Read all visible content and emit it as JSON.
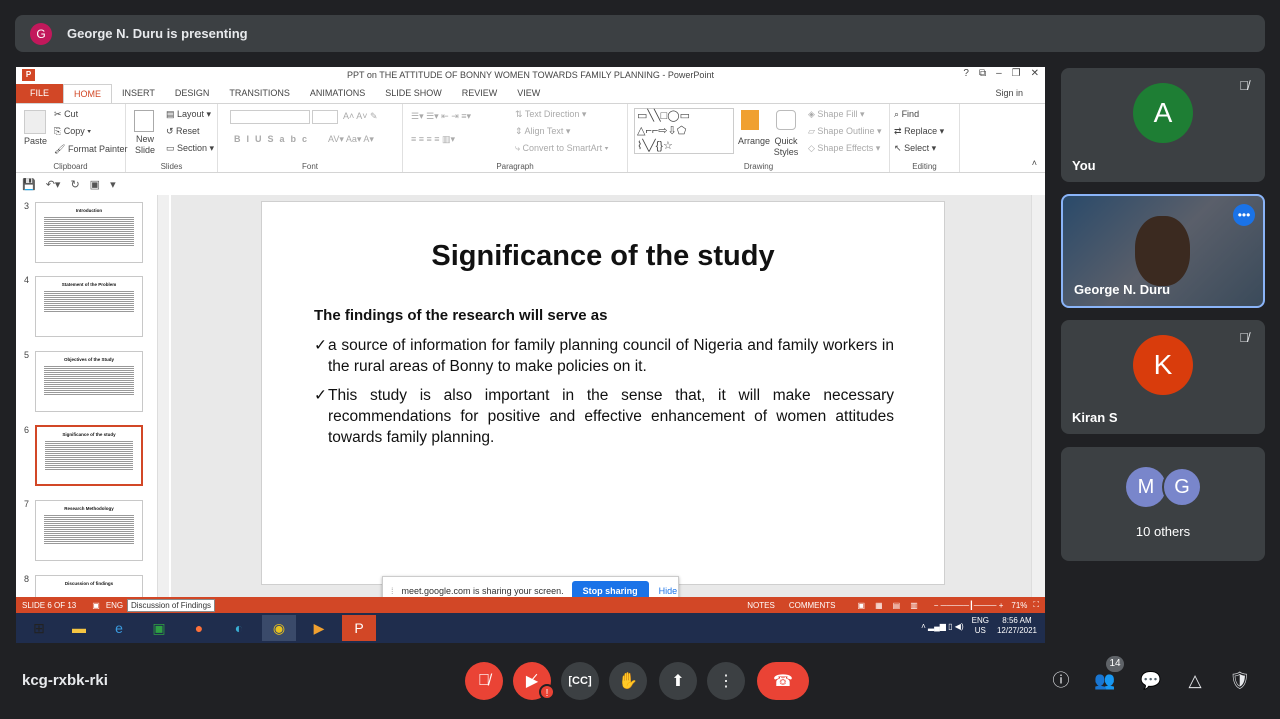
{
  "presenter": {
    "initial": "G",
    "text": "George N. Duru is presenting"
  },
  "ppt": {
    "window_title": "PPT on THE ATTITUDE OF BONNY WOMEN TOWARDS FAMILY PLANNING - PowerPoint",
    "tabs": [
      "FILE",
      "HOME",
      "INSERT",
      "DESIGN",
      "TRANSITIONS",
      "ANIMATIONS",
      "SLIDE SHOW",
      "REVIEW",
      "VIEW"
    ],
    "signin": "Sign in",
    "ribbon": {
      "clipboard": {
        "paste": "Paste",
        "cut": "Cut",
        "copy": "Copy",
        "format_painter": "Format Painter",
        "label": "Clipboard"
      },
      "slides": {
        "new_slide": "New Slide",
        "layout": "Layout",
        "reset": "Reset",
        "section": "Section",
        "label": "Slides"
      },
      "font": {
        "label": "Font"
      },
      "paragraph": {
        "text_direction": "Text Direction",
        "align_text": "Align Text",
        "smartart": "Convert to SmartArt",
        "label": "Paragraph"
      },
      "drawing": {
        "arrange": "Arrange",
        "quick_styles": "Quick Styles",
        "shape_fill": "Shape Fill",
        "shape_outline": "Shape Outline",
        "shape_effects": "Shape Effects",
        "label": "Drawing"
      },
      "editing": {
        "find": "Find",
        "replace": "Replace",
        "select": "Select",
        "label": "Editing"
      }
    },
    "thumbnails": [
      {
        "num": "3",
        "title": "Introduction"
      },
      {
        "num": "4",
        "title": "Statement of the Problem"
      },
      {
        "num": "5",
        "title": "Objectives of the Study"
      },
      {
        "num": "6",
        "title": "Significance of the study"
      },
      {
        "num": "7",
        "title": "Research Methodology"
      },
      {
        "num": "8",
        "title": "Discussion of findings"
      }
    ],
    "slide": {
      "title": "Significance of the study",
      "subtitle": "The findings of the research will serve as",
      "bullets": [
        "a source of information for family planning council of Nigeria and family workers in the rural areas of Bonny to make policies on it.",
        "This study is also important in the sense that, it will make necessary recommendations for positive and effective enhancement of women attitudes towards family planning."
      ]
    },
    "share_bar": {
      "text": "meet.google.com is sharing your screen.",
      "stop": "Stop sharing",
      "hide": "Hide"
    },
    "tooltip": "Discussion of Findings",
    "status": {
      "slide": "SLIDE 6 OF 13",
      "lang": "ENG",
      "notes": "NOTES",
      "comments": "COMMENTS",
      "zoom": "71%"
    },
    "tray": {
      "lang": "ENG",
      "region": "US",
      "time": "8:56 AM",
      "date": "12/27/2021"
    }
  },
  "participants": [
    {
      "initial": "A",
      "name": "You",
      "color": "#1e7e34"
    },
    {
      "name": "George N. Duru"
    },
    {
      "initial": "K",
      "name": "Kiran S",
      "color": "#d93c0c"
    },
    {
      "initials": [
        "M",
        "G"
      ],
      "name": "10 others"
    }
  ],
  "meeting_code": "kcg-rxbk-rki",
  "people_count": "14"
}
